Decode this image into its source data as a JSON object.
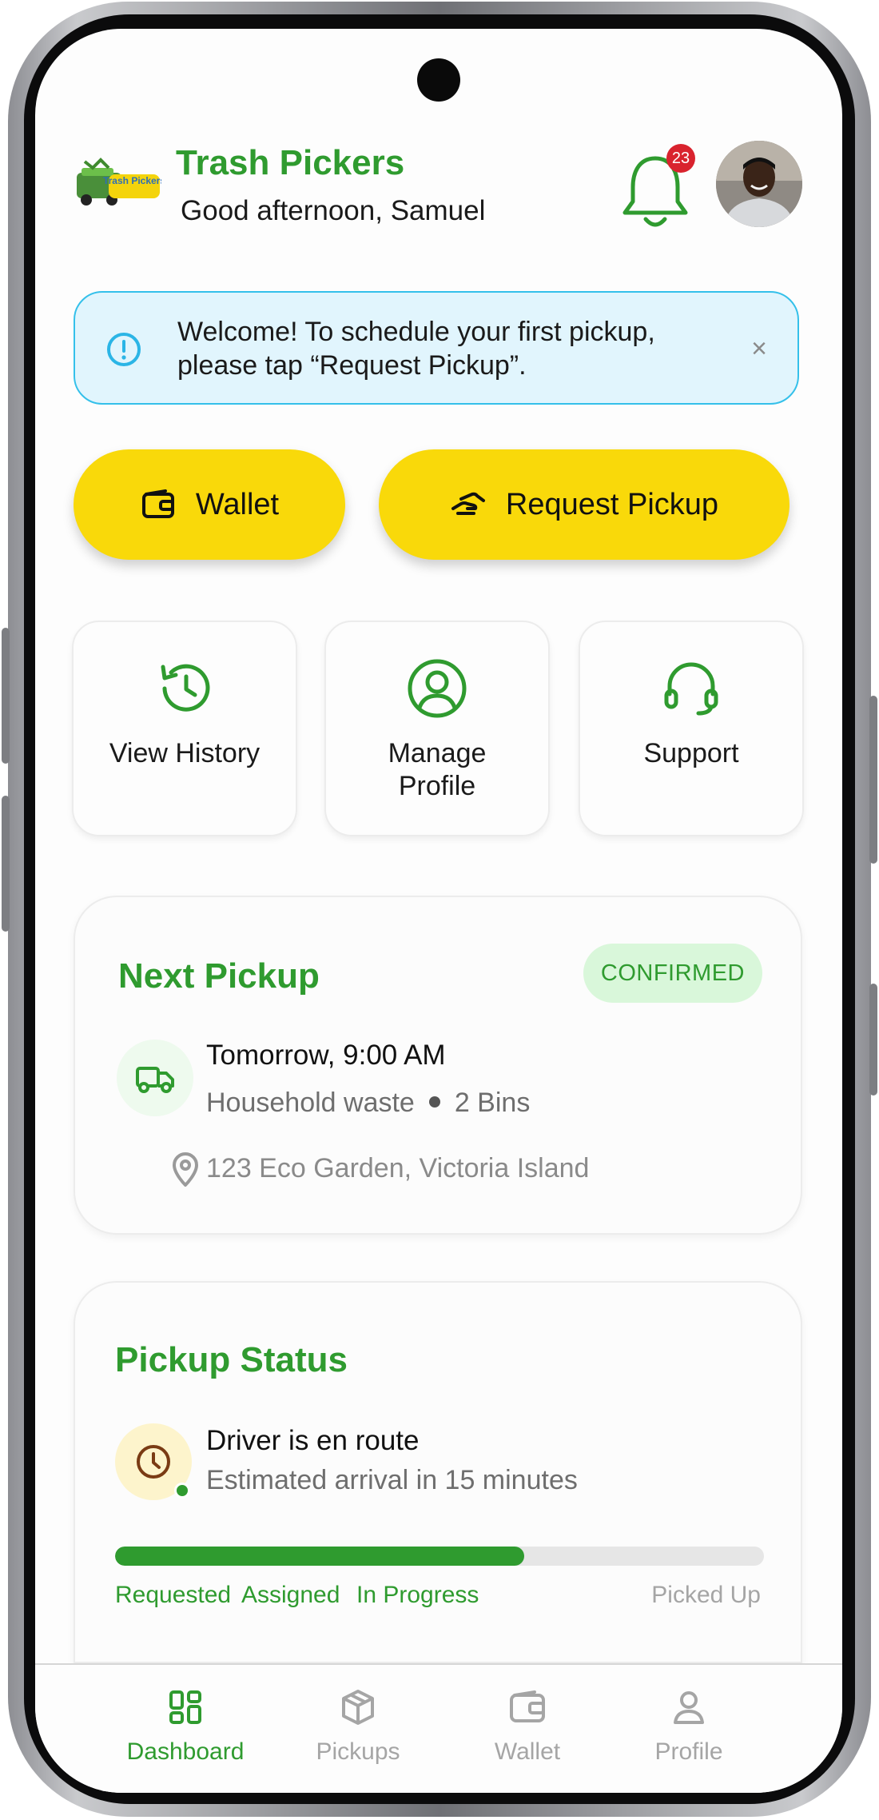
{
  "header": {
    "logo_text": "Trash Pickers",
    "app_title": "Trash Pickers",
    "greeting": "Good afternoon, Samuel",
    "notification_count": "23"
  },
  "banner": {
    "message": "Welcome! To schedule your first pickup, please tap “Request Pickup”.",
    "close_glyph": "×"
  },
  "actions": {
    "wallet_label": "Wallet",
    "request_pickup_label": "Request Pickup"
  },
  "tiles": [
    {
      "label": "View History",
      "icon": "history-icon"
    },
    {
      "label": "Manage\nProfile",
      "icon": "user-circle-icon"
    },
    {
      "label": "Support",
      "icon": "headset-icon"
    }
  ],
  "next_pickup": {
    "title": "Next Pickup",
    "status": "CONFIRMED",
    "time": "Tomorrow, 9:00 AM",
    "waste_type": "Household waste",
    "bins": "2 Bins",
    "address": "123 Eco Garden,  Victoria Island"
  },
  "pickup_status": {
    "title": "Pickup Status",
    "headline": "Driver is en route",
    "eta": "Estimated arrival in 15 minutes",
    "progress": 0.63,
    "steps": [
      {
        "label": "Requested",
        "done": true
      },
      {
        "label": "Assigned",
        "done": true
      },
      {
        "label": "In Progress",
        "done": true
      },
      {
        "label": "Picked Up",
        "done": false
      }
    ]
  },
  "nav": [
    {
      "label": "Dashboard",
      "active": true
    },
    {
      "label": "Pickups",
      "active": false
    },
    {
      "label": "Wallet",
      "active": false
    },
    {
      "label": "Profile",
      "active": false
    }
  ],
  "colors": {
    "brand_green": "#2f9b2f",
    "accent_yellow": "#f9d90a",
    "info_blue": "#34c0ea",
    "badge_red": "#d9232e",
    "inactive_gray": "#a5a5a5"
  }
}
